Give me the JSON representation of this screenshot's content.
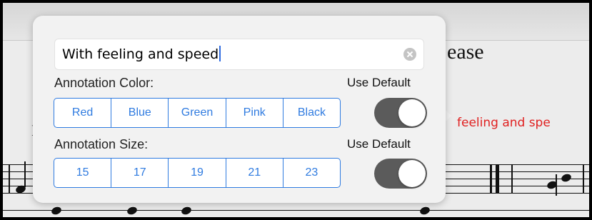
{
  "background": {
    "score_title_fragment": "ease",
    "annotation_preview": "feeling and spe",
    "stray_letter": "I"
  },
  "popover": {
    "text_field": {
      "value": "With feeling and speed"
    },
    "color_section": {
      "label": "Annotation Color:",
      "use_default_label": "Use Default",
      "use_default_on": true,
      "options": [
        "Red",
        "Blue",
        "Green",
        "Pink",
        "Black"
      ]
    },
    "size_section": {
      "label": "Annotation Size:",
      "use_default_label": "Use Default",
      "use_default_on": true,
      "options": [
        "15",
        "17",
        "19",
        "21",
        "23"
      ]
    }
  },
  "colors": {
    "accent": "#2f7be0",
    "annotation_red": "#e02020",
    "toggle_track": "#5b5b5b"
  },
  "icons": [
    "clear-text-icon"
  ]
}
